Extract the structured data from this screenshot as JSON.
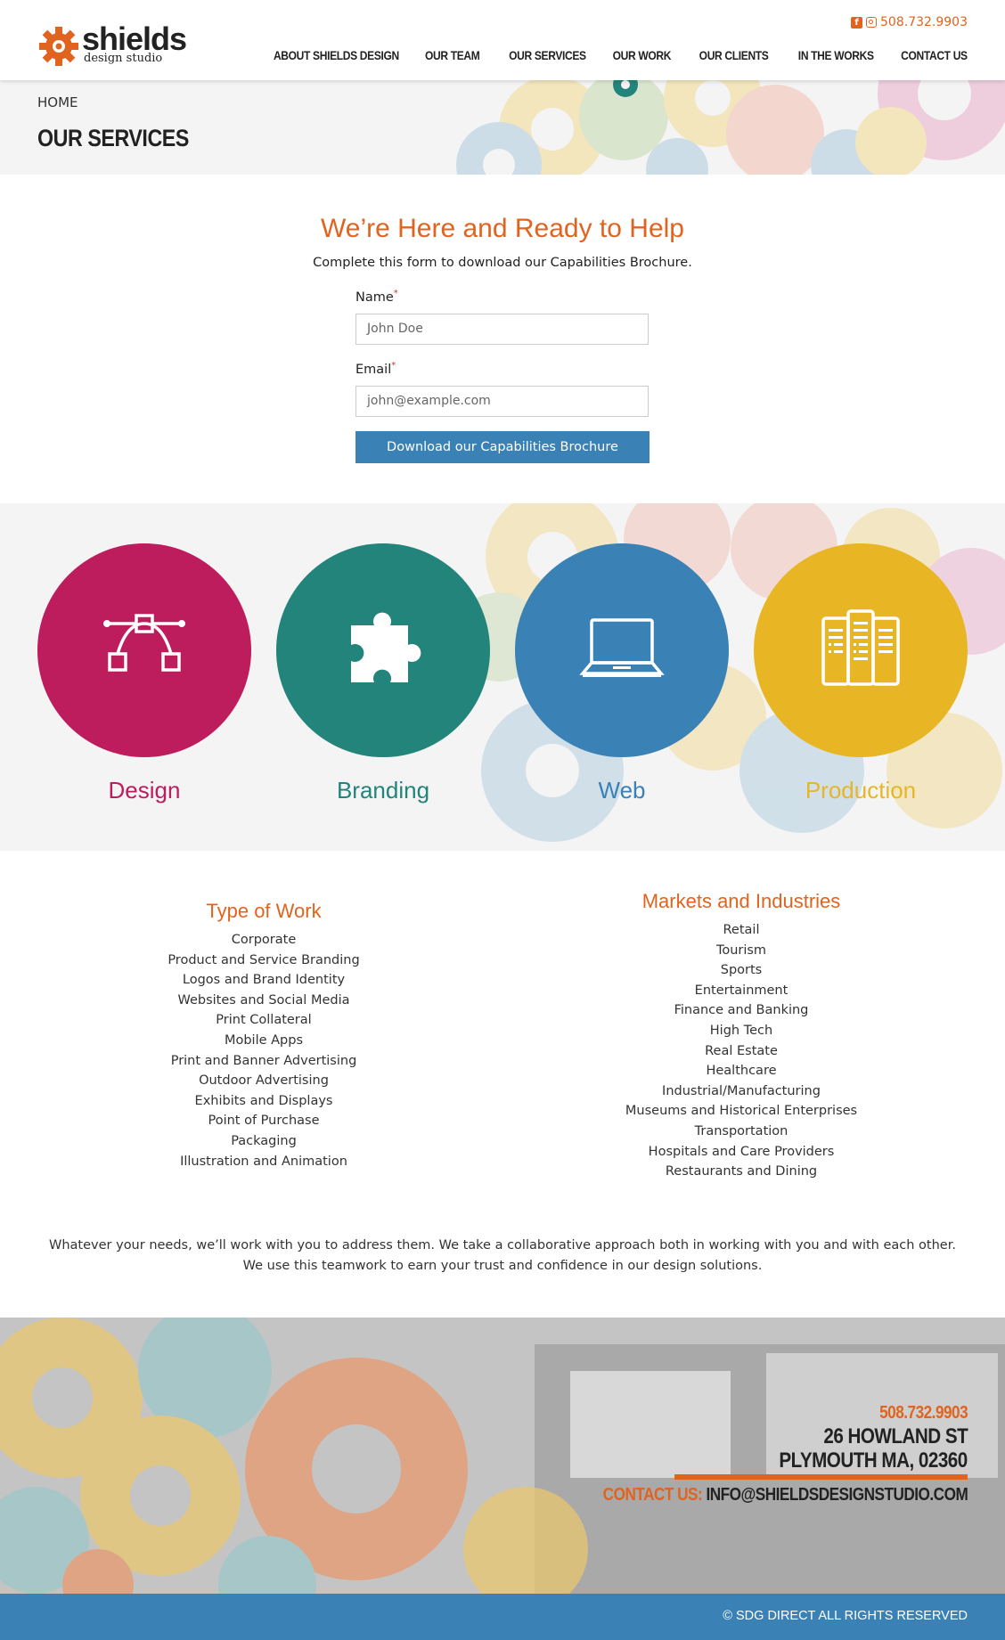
{
  "header": {
    "logo_name": "shields",
    "logo_sub": "design studio",
    "phone": "508.732.9903",
    "nav": [
      "ABOUT SHIELDS DESIGN",
      "OUR TEAM",
      "OUR SERVICES",
      "OUR WORK",
      "OUR CLIENTS",
      "IN THE WORKS",
      "CONTACT US"
    ]
  },
  "banner": {
    "breadcrumb": "HOME",
    "title": "OUR SERVICES"
  },
  "form": {
    "title": "We’re Here and Ready to Help",
    "description": "Complete this form to download our Capabilities Brochure.",
    "name_label": "Name",
    "name_placeholder": "John Doe",
    "email_label": "Email",
    "email_placeholder": "john@example.com",
    "required_mark": "*",
    "button_label": "Download our Capabilities Brochure"
  },
  "services": [
    {
      "label": "Design",
      "color": "#be1d5d",
      "icon": "vector-path-icon"
    },
    {
      "label": "Branding",
      "color": "#22847a",
      "icon": "puzzle-piece-icon"
    },
    {
      "label": "Web",
      "color": "#3a81b5",
      "icon": "laptop-icon"
    },
    {
      "label": "Production",
      "color": "#e8b625",
      "icon": "brochure-icon"
    }
  ],
  "type_of_work": {
    "title": "Type of Work",
    "items": [
      "Corporate",
      "Product and Service Branding",
      "Logos and Brand Identity",
      "Websites and Social Media",
      "Print Collateral",
      "Mobile Apps",
      "Print and Banner Advertising",
      "Outdoor Advertising",
      "Exhibits and Displays",
      "Point of Purchase",
      "Packaging",
      "Illustration and Animation"
    ]
  },
  "markets": {
    "title": "Markets and Industries",
    "items": [
      "Retail",
      "Tourism",
      "Sports",
      "Entertainment",
      "Finance and Banking",
      "High Tech",
      "Real Estate",
      "Healthcare",
      "Industrial/Manufacturing",
      "Museums and Historical Enterprises",
      "Transportation",
      "Hospitals and Care Providers",
      "Restaurants and Dining"
    ]
  },
  "closing": "Whatever your needs, we’ll work with you to address them. We take a collaborative approach both in working with you and with each other. We use this teamwork to earn your trust and confidence in our design solutions.",
  "footer": {
    "phone": "508.732.9903",
    "street": "26 HOWLAND ST",
    "city": "PLYMOUTH MA, 02360",
    "contact_label": "CONTACT US:",
    "email": "INFO@SHIELDSDESIGNSTUDIO.COM",
    "copyright": "© SDG DIRECT ALL RIGHTS RESERVED"
  },
  "colors": {
    "accent": "#e0641f",
    "blue": "#3a81b5",
    "magenta": "#be1d5d",
    "teal": "#22847a",
    "yellow": "#e8b625"
  }
}
